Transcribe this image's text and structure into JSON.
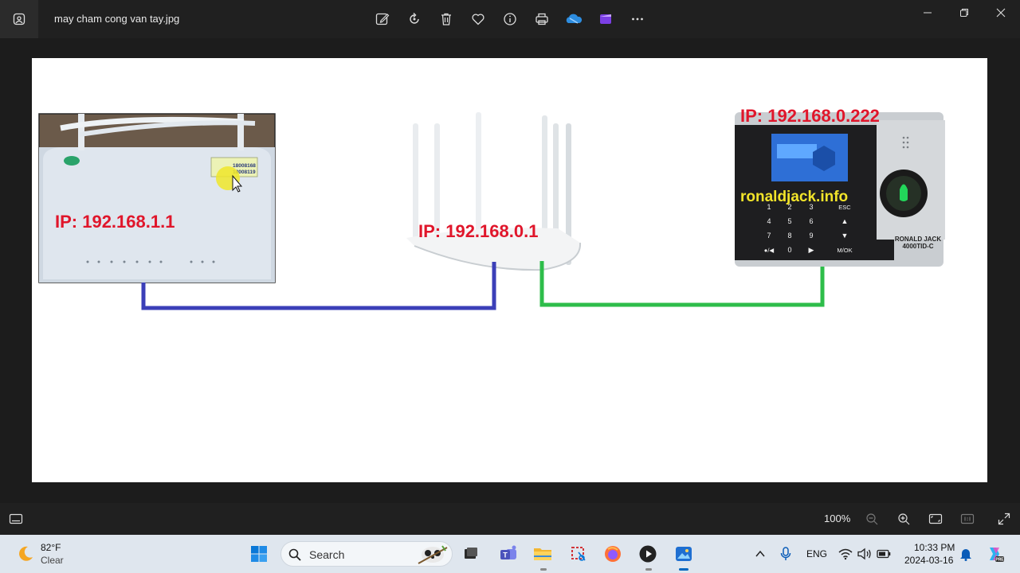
{
  "window": {
    "title": "may cham cong van tay.jpg",
    "toolbar": [
      "edit-image",
      "rotate",
      "delete",
      "favorite",
      "file-info",
      "print",
      "onedrive",
      "clipchamp",
      "more"
    ]
  },
  "image": {
    "labels": {
      "modem_ip": "IP: 192.168.1.1",
      "router_ip": "IP: 192.168.0.1",
      "attendance_ip": "IP: 192.168.0.222",
      "brand_site": "ronaldjack.info",
      "model": "RONALD JACK",
      "model_code": "4000TID-C",
      "sticker_line1": "18008168",
      "sticker_line2": "18008119"
    },
    "keypad": [
      "1",
      "2",
      "3",
      "ESC",
      "4",
      "5",
      "6",
      "▲",
      "7",
      "8",
      "9",
      "▼",
      "●/◀",
      "0",
      "▶",
      "M/OK"
    ],
    "cable_colors": {
      "modem_to_router": "#3b3fb8",
      "router_to_device": "#2ebd4a"
    }
  },
  "statusbar": {
    "zoom": "100%"
  },
  "taskbar": {
    "weather_temp": "82°F",
    "weather_desc": "Clear",
    "search_label": "Search",
    "language": "ENG",
    "time": "10:33 PM",
    "date": "2024-03-16"
  },
  "colors": {
    "accent": "#0067c0",
    "ip_red": "#e0162b",
    "device_yellow": "#f2e42a"
  }
}
